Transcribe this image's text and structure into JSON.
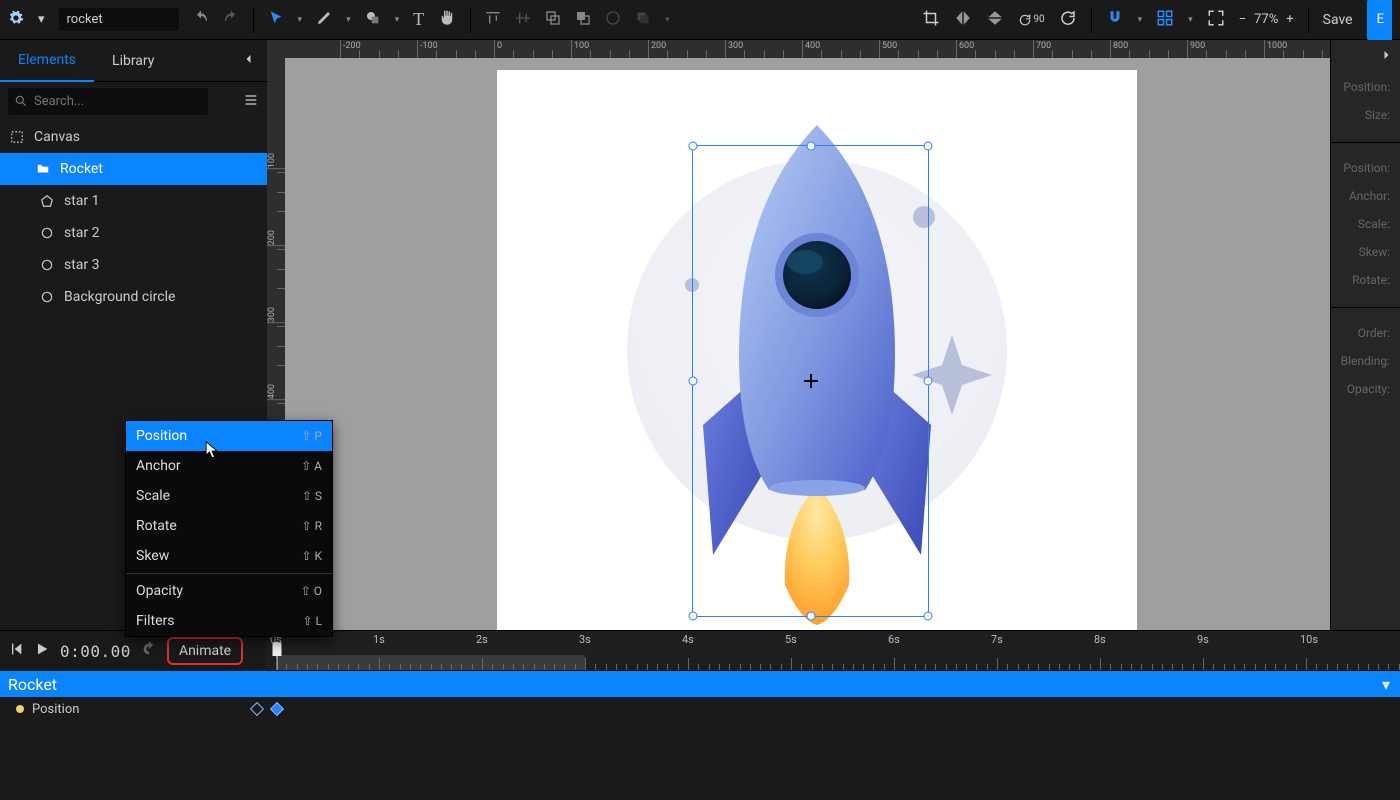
{
  "project_name": "rocket",
  "zoom_label": "77%",
  "save_label": "Save",
  "export_initial": "E",
  "left": {
    "tabs": {
      "elements": "Elements",
      "library": "Library"
    },
    "search_placeholder": "Search...",
    "layers": {
      "canvas": "Canvas",
      "rocket": "Rocket",
      "star1": "star 1",
      "star2": "star 2",
      "star3": "star 3",
      "bgcircle": "Background circle"
    }
  },
  "context_menu": {
    "position": "Position",
    "position_sc": "⇧ P",
    "anchor": "Anchor",
    "anchor_sc": "⇧ A",
    "scale": "Scale",
    "scale_sc": "⇧ S",
    "rotate": "Rotate",
    "rotate_sc": "⇧ R",
    "skew": "Skew",
    "skew_sc": "⇧ K",
    "opacity": "Opacity",
    "opacity_sc": "⇧ O",
    "filters": "Filters",
    "filters_sc": "⇧ L"
  },
  "right": {
    "position": "Position:",
    "size": "Size:",
    "position2": "Position:",
    "anchor": "Anchor:",
    "scale": "Scale:",
    "skew": "Skew:",
    "rotate": "Rotate:",
    "order": "Order:",
    "blending": "Blending:",
    "opacity": "Opacity:"
  },
  "ruler_h": [
    "-200",
    "-100",
    "0",
    "100",
    "200",
    "300",
    "400",
    "500",
    "600",
    "700",
    "800",
    "900",
    "1000"
  ],
  "ruler_v": [
    "100",
    "200",
    "300",
    "400"
  ],
  "timeline": {
    "time": "0:00.00",
    "animate": "Animate",
    "seconds": [
      "0s",
      "1s",
      "2s",
      "3s",
      "4s",
      "5s",
      "6s",
      "7s",
      "8s",
      "9s",
      "10s"
    ],
    "object": "Rocket",
    "property": "Position"
  }
}
